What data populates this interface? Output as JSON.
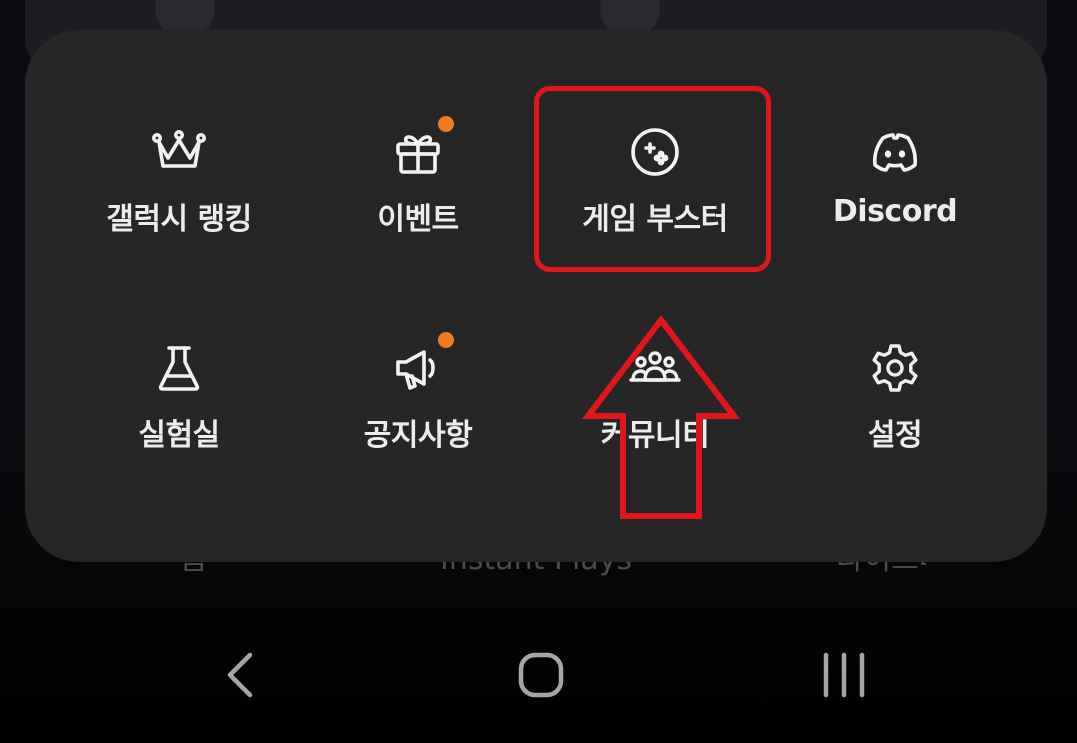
{
  "background": {
    "tabs": [
      "홈",
      "Instant Plays",
      "라이브러리"
    ]
  },
  "menu": {
    "items": [
      {
        "label": "갤럭시 랭킹",
        "icon": "crown-icon",
        "badge": false
      },
      {
        "label": "이벤트",
        "icon": "gift-icon",
        "badge": true
      },
      {
        "label": "게임 부스터",
        "icon": "gamepad-icon",
        "badge": false,
        "highlighted": true
      },
      {
        "label": "Discord",
        "icon": "discord-icon",
        "badge": false
      },
      {
        "label": "실험실",
        "icon": "flask-icon",
        "badge": false
      },
      {
        "label": "공지사항",
        "icon": "megaphone-icon",
        "badge": true
      },
      {
        "label": "커뮤니티",
        "icon": "community-icon",
        "badge": false
      },
      {
        "label": "설정",
        "icon": "gear-icon",
        "badge": false
      }
    ]
  },
  "navbar": {
    "buttons": [
      {
        "icon": "back-icon"
      },
      {
        "icon": "home-icon"
      },
      {
        "icon": "recents-icon"
      }
    ]
  },
  "colors": {
    "panel": "#262626",
    "badge": "#f07b1f",
    "annotation": "#e1161c",
    "text": "#ececec"
  }
}
